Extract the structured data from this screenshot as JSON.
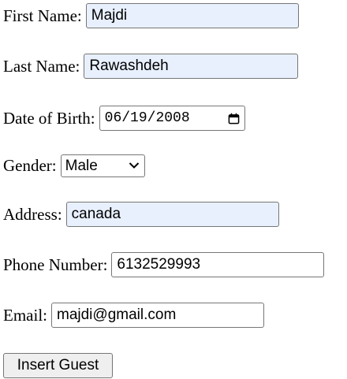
{
  "form": {
    "first_name": {
      "label": "First Name:",
      "value": "Majdi"
    },
    "last_name": {
      "label": "Last Name:",
      "value": "Rawashdeh"
    },
    "date_of_birth": {
      "label": "Date of Birth:",
      "value": "06/19/2008"
    },
    "gender": {
      "label": "Gender:",
      "selected": "Male"
    },
    "address": {
      "label": "Address:",
      "value": "canada"
    },
    "phone": {
      "label": "Phone Number:",
      "value": "6132529993"
    },
    "email": {
      "label": "Email:",
      "value": "majdi@gmail.com"
    },
    "submit_label": "Insert Guest"
  },
  "icons": {
    "date_picker": "calendar-icon",
    "select_arrow": "chevron-down-icon"
  },
  "colors": {
    "autofill_background": "#e8f0fe",
    "field_border": "#767676",
    "button_background": "#efefef"
  }
}
